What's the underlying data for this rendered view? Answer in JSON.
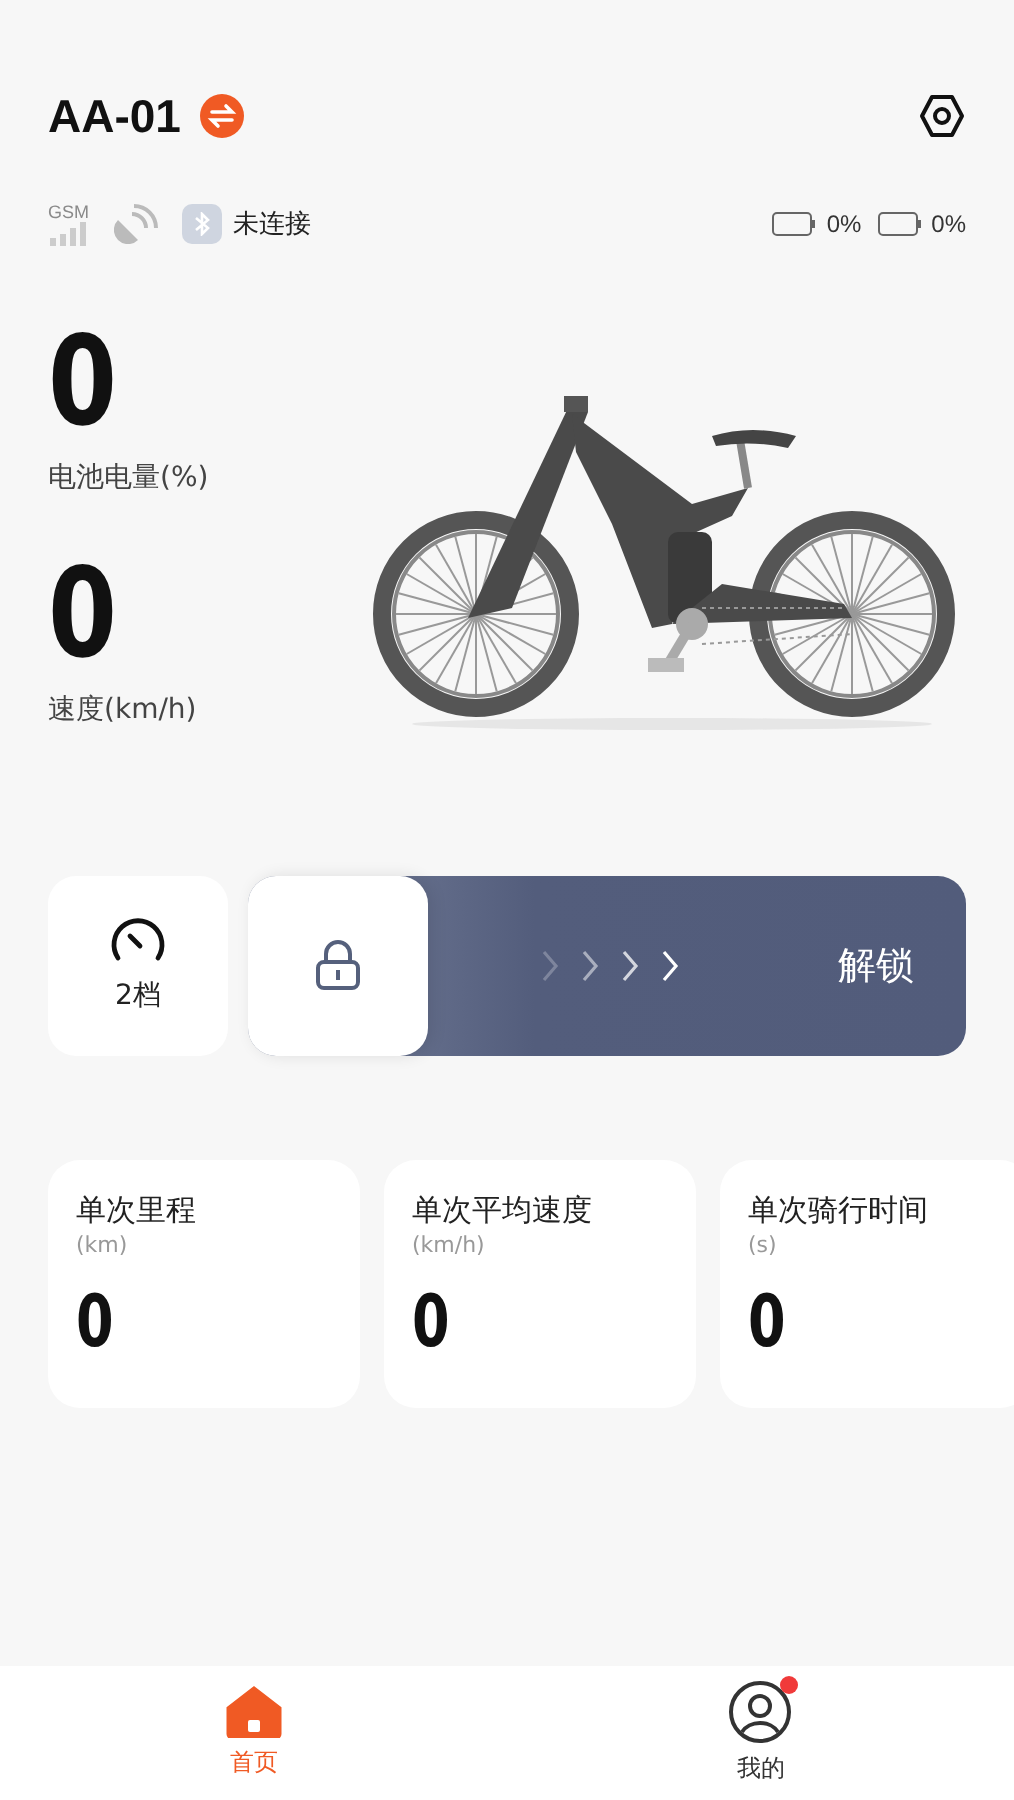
{
  "header": {
    "title": "AA-01"
  },
  "status": {
    "gsm_label": "GSM",
    "bluetooth": {
      "connected": false,
      "text": "未连接"
    },
    "batteries": [
      "0%",
      "0%"
    ]
  },
  "metrics": [
    {
      "value": "0",
      "label": "电池电量(%)"
    },
    {
      "value": "0",
      "label": "速度(km/h)"
    }
  ],
  "controls": {
    "gear": "2档",
    "unlock": "解锁",
    "locked": true
  },
  "stats": [
    {
      "label": "单次里程",
      "unit": "(km)",
      "value": "0"
    },
    {
      "label": "单次平均速度",
      "unit": "(km/h)",
      "value": "0"
    },
    {
      "label": "单次骑行时间",
      "unit": "(s)",
      "value": "0"
    }
  ],
  "tabs": [
    {
      "label": "首页",
      "kind": "home",
      "selected": true,
      "dot": false
    },
    {
      "label": "我的",
      "kind": "profile",
      "selected": false,
      "dot": true
    }
  ]
}
